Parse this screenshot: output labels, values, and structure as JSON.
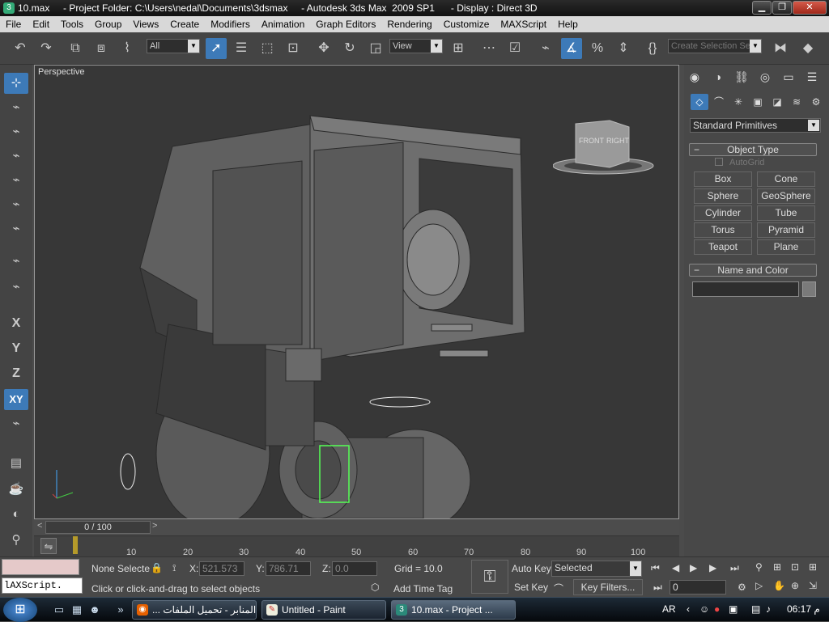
{
  "titlebar": {
    "title": "10.max     - Project Folder: C:\\Users\\nedal\\Documents\\3dsmax     - Autodesk 3ds Max  2009 SP1      - Display : Direct 3D",
    "minimize": "▁",
    "maximize": "❐",
    "close": "✕"
  },
  "menu": [
    "File",
    "Edit",
    "Tools",
    "Group",
    "Views",
    "Create",
    "Modifiers",
    "Animation",
    "Graph Editors",
    "Rendering",
    "Customize",
    "MAXScript",
    "Help"
  ],
  "toolbar": {
    "filter_value": "All",
    "refcoord_value": "View",
    "named_selection_placeholder": "Create Selection Set"
  },
  "left_toolbar": {
    "axis_x": "X",
    "axis_y": "Y",
    "axis_z": "Z",
    "axis_xy": "XY"
  },
  "viewport": {
    "label": "Perspective",
    "viewcube_front": "FRONT",
    "viewcube_right": "RIGHT"
  },
  "command_panel": {
    "category": "Standard Primitives",
    "object_type_title": "Object Type",
    "autogrid_label": "AutoGrid",
    "buttons": [
      "Box",
      "Cone",
      "Sphere",
      "GeoSphere",
      "Cylinder",
      "Tube",
      "Torus",
      "Pyramid",
      "Teapot",
      "Plane"
    ],
    "name_color_title": "Name and Color",
    "rollout_minus": "−"
  },
  "timeline": {
    "slider_label": "0 / 100",
    "ticks": [
      "10",
      "20",
      "30",
      "40",
      "50",
      "60",
      "70",
      "80",
      "90",
      "100"
    ]
  },
  "status": {
    "maxscript_text": "lAXScript.",
    "selection_status": "None Selecte",
    "prompt": "Click or click-and-drag to select objects",
    "x_label": "X:",
    "x_value": "521.573",
    "y_label": "Y:",
    "y_value": "786.71",
    "z_label": "Z:",
    "z_value": "0.0",
    "grid": "Grid = 10.0",
    "add_time_tag": "Add Time Tag",
    "auto_key": "Auto Key",
    "set_key": "Set Key",
    "key_mode_value": "Selected",
    "key_filters": "Key Filters...",
    "frame_value": "0"
  },
  "taskbar": {
    "tasks": [
      "... المنابر - تحميل الملفات",
      "Untitled - Paint",
      "10.max     - Project ..."
    ],
    "lang": "AR",
    "time": "06:17 م"
  }
}
